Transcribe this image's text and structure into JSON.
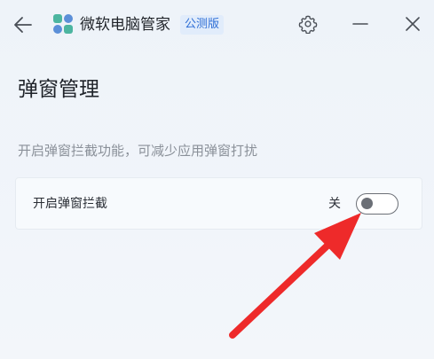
{
  "titlebar": {
    "app_name": "微软电脑管家",
    "badge": "公测版",
    "icons": {
      "back": "back-arrow-icon",
      "logo": "app-logo-icon",
      "settings": "gear-icon",
      "minimize": "minimize-icon",
      "close": "close-icon"
    }
  },
  "page": {
    "title": "弹窗管理",
    "description": "开启弹窗拦截功能，可减少应用弹窗打扰"
  },
  "setting": {
    "label": "开启弹窗拦截",
    "state_label": "关",
    "enabled": false
  },
  "colors": {
    "badge_bg": "#e1ecfb",
    "badge_text": "#2f6fd6",
    "annotation_arrow": "#ee2a2a",
    "logo_green": "#4cb5a0",
    "logo_blue": "#5b8fd8"
  }
}
